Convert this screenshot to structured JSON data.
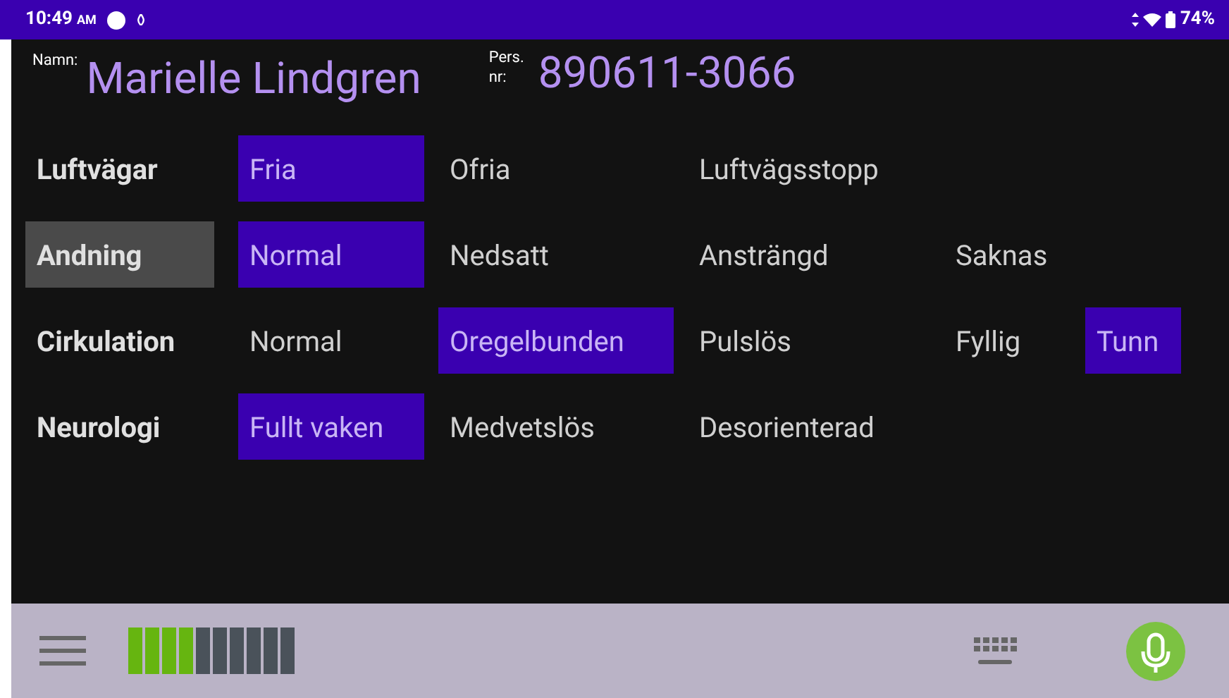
{
  "status_bar": {
    "time": "10:49",
    "ampm": "AM",
    "battery": "74%"
  },
  "patient": {
    "name_label": "Namn:",
    "name": "Marielle Lindgren",
    "id_label_top": "Pers.",
    "id_label_bottom": "nr:",
    "id": "890611-3066"
  },
  "rows": [
    {
      "label": "Luftvägar",
      "selected": false,
      "options": [
        {
          "label": "Fria",
          "selected": true
        },
        {
          "label": "Ofria",
          "selected": false
        },
        {
          "label": "Luftvägsstopp",
          "selected": false
        }
      ]
    },
    {
      "label": "Andning",
      "selected": true,
      "options": [
        {
          "label": "Normal",
          "selected": true
        },
        {
          "label": "Nedsatt",
          "selected": false
        },
        {
          "label": "Ansträngd",
          "selected": false
        },
        {
          "label": "Saknas",
          "selected": false
        }
      ]
    },
    {
      "label": "Cirkulation",
      "selected": false,
      "options": [
        {
          "label": "Normal",
          "selected": false
        },
        {
          "label": "Oregelbunden",
          "selected": true
        },
        {
          "label": "Pulslös",
          "selected": false
        },
        {
          "label": "Fyllig",
          "selected": false
        },
        {
          "label": "Tunn",
          "selected": true
        }
      ]
    },
    {
      "label": "Neurologi",
      "selected": false,
      "options": [
        {
          "label": "Fullt vaken",
          "selected": true
        },
        {
          "label": "Medvetslös",
          "selected": false
        },
        {
          "label": "Desorienterad",
          "selected": false
        }
      ]
    }
  ]
}
